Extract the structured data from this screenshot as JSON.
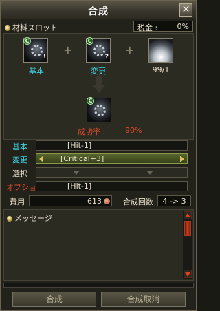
{
  "window": {
    "title": "合成",
    "close_symbol": "✕"
  },
  "header": {
    "slot_label": "材料スロット",
    "tax_label": "税金 :",
    "tax_value": "0%"
  },
  "materials": {
    "base": {
      "label": "基本",
      "badge": "C",
      "mark": "!"
    },
    "change": {
      "label": "変更",
      "badge": "C",
      "mark": "?"
    },
    "catalyst": {
      "label": "99/1"
    },
    "plus_symbol": "+"
  },
  "result": {
    "badge": "C",
    "success_label": "成功率 :",
    "success_value": "90%"
  },
  "options": {
    "base": {
      "label": "基本",
      "value": "[Hit-1]",
      "label_color": "#3ed0e0"
    },
    "change": {
      "label": "変更",
      "value": "[Critical+3]",
      "label_color": "#3ed0e0"
    },
    "select": {
      "label": "選択",
      "value": ""
    },
    "option": {
      "label": "オプション",
      "value": "[Hit-1]",
      "label_color": "#e04a2a"
    }
  },
  "cost": {
    "label": "費用",
    "value": "613"
  },
  "count": {
    "label": "合成回数",
    "value": "4 -> 3"
  },
  "messages": {
    "label": "メッセージ"
  },
  "buttons": {
    "combine": "合成",
    "cancel": "合成取消"
  },
  "colors": {
    "accent_cyan": "#3ed0e0",
    "accent_red": "#e04a2a",
    "panel": "#2c2b22"
  }
}
